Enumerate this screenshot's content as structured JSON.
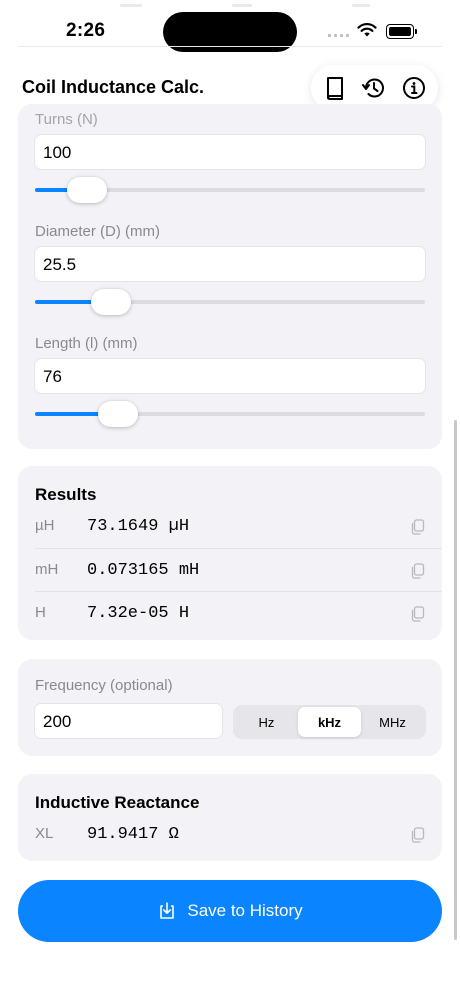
{
  "status": {
    "time": "2:26"
  },
  "nav": {
    "title": "Coil Inductance Calc."
  },
  "inputs": {
    "turns": {
      "label": "Turns (N)",
      "value": "100",
      "fraction": 0.09
    },
    "diameter": {
      "label": "Diameter (D) (mm)",
      "value": "25.5",
      "fraction": 0.16
    },
    "length": {
      "label": "Length (l) (mm)",
      "value": "76",
      "fraction": 0.18
    }
  },
  "results": {
    "title": "Results",
    "rows": [
      {
        "unit": "µH",
        "value": "73.1649 µH"
      },
      {
        "unit": "mH",
        "value": "0.073165 mH"
      },
      {
        "unit": "H",
        "value": "7.32e-05 H"
      }
    ]
  },
  "frequency": {
    "label": "Frequency (optional)",
    "value": "200",
    "units": [
      "Hz",
      "kHz",
      "MHz"
    ],
    "selected": "kHz"
  },
  "reactance": {
    "title": "Inductive Reactance",
    "unit": "XL",
    "value": "91.9417 Ω"
  },
  "save": {
    "label": "Save to History"
  },
  "colors": {
    "accent": "#0a84ff",
    "card": "#f2f2f7",
    "secondary_text": "#8a8a8e"
  },
  "icons": [
    "book-icon",
    "history-icon",
    "info-icon",
    "copy-icon",
    "save-download-icon",
    "wifi-icon",
    "battery-icon"
  ]
}
